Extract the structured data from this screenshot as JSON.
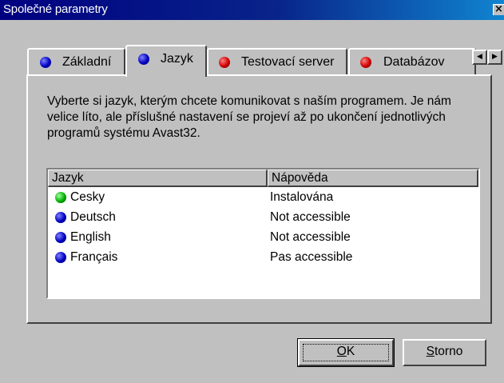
{
  "window": {
    "title": "Společné parametry"
  },
  "tabs": [
    {
      "label": "Základní",
      "icon": "blue-dot-icon",
      "color": "#0000c0"
    },
    {
      "label": "Jazyk",
      "icon": "blue-dot-icon",
      "color": "#0000c0"
    },
    {
      "label": "Testovací server",
      "icon": "red-dot-icon",
      "color": "#d00000"
    },
    {
      "label": "Databázov",
      "icon": "red-dot-icon",
      "color": "#d00000"
    }
  ],
  "tab_scroll": {
    "left": "◀",
    "right": "▶"
  },
  "description": "Vyberte si jazyk, kterým chcete komunikovat s naším programem. Je nám velice líto, ale příslušné nastavení se projeví až po ukončení jednotlivých programů systému Avast32.",
  "list": {
    "columns": [
      "Jazyk",
      "Nápověda"
    ],
    "rows": [
      {
        "name": "Cesky",
        "help": "Instalována",
        "icon": "green-dot-icon",
        "color": "#00b000"
      },
      {
        "name": "Deutsch",
        "help": "Not accessible",
        "icon": "blue-dot-icon",
        "color": "#0000c0"
      },
      {
        "name": "English",
        "help": "Not accessible",
        "icon": "blue-dot-icon",
        "color": "#0000c0"
      },
      {
        "name": "Français",
        "help": "Pas accessible",
        "icon": "blue-dot-icon",
        "color": "#0000c0"
      }
    ]
  },
  "buttons": {
    "ok_underline": "O",
    "ok_rest": "K",
    "cancel_underline": "S",
    "cancel_rest": "torno"
  },
  "colors": {
    "title_bar": "#000080",
    "dialog_face": "#c0c0c0",
    "selected_row": "#ffffff"
  }
}
